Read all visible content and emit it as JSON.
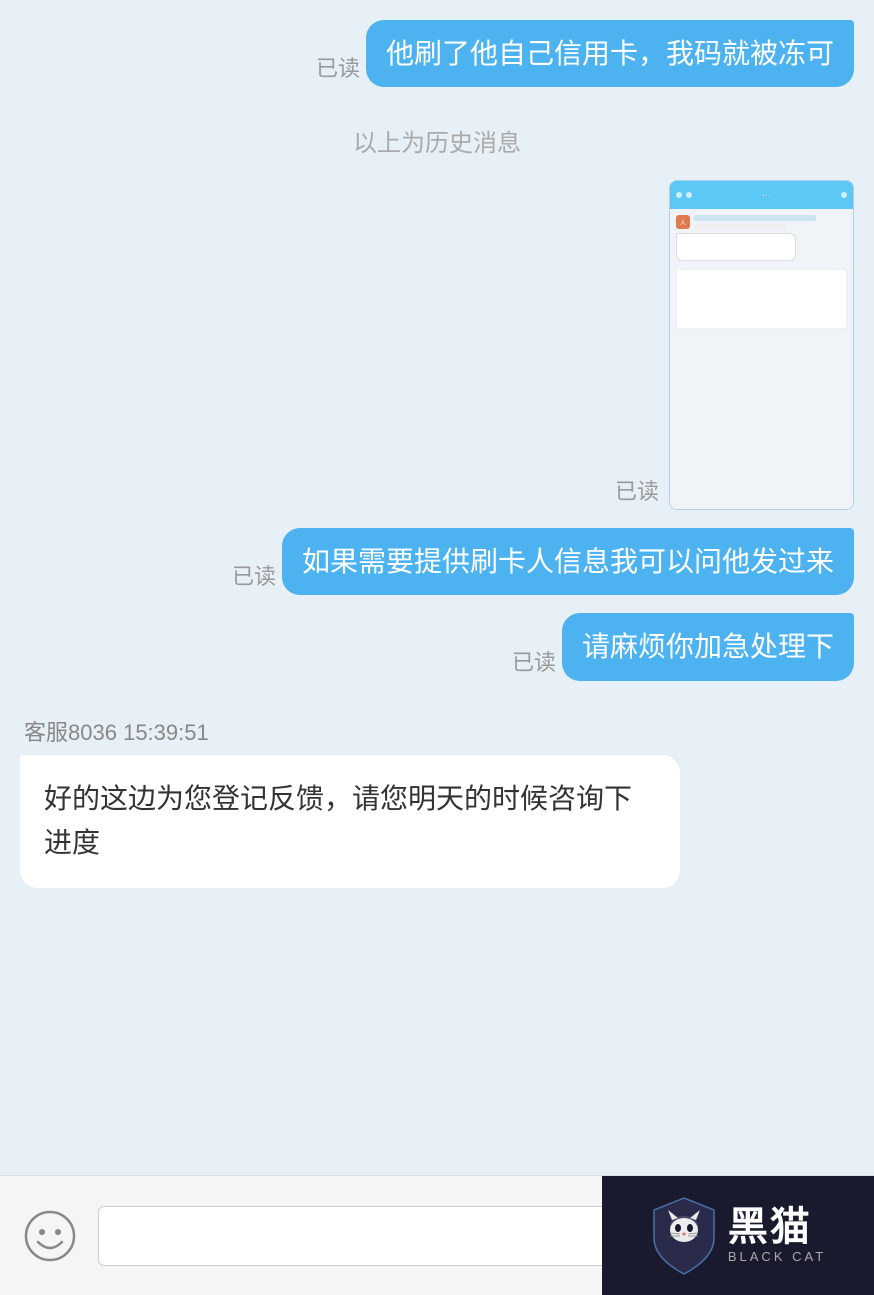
{
  "messages": [
    {
      "id": "msg1",
      "type": "sent",
      "text": "他刷了他自己信用卡，我码就被冻可",
      "read": "已读"
    },
    {
      "id": "divider",
      "type": "divider",
      "text": "以上为历史消息"
    },
    {
      "id": "msg2",
      "type": "sent-image",
      "read": "已读"
    },
    {
      "id": "msg3",
      "type": "sent",
      "text": "如果需要提供刷卡人信息我可以问他发过来",
      "read": "已读"
    },
    {
      "id": "msg4",
      "type": "sent",
      "text": "请麻烦你加急处理下",
      "read": "已读"
    },
    {
      "id": "msg5",
      "type": "received",
      "sender": "客服8036",
      "timestamp": "15:39:51",
      "text": "好的这边为您登记反馈，请您明天的时候咨询下进度"
    }
  ],
  "toolbar": {
    "emoji_label": "😊",
    "add_label": "⊕",
    "input_placeholder": ""
  },
  "watermark": {
    "chinese": "黑猫",
    "english": "BLACK CAT"
  }
}
